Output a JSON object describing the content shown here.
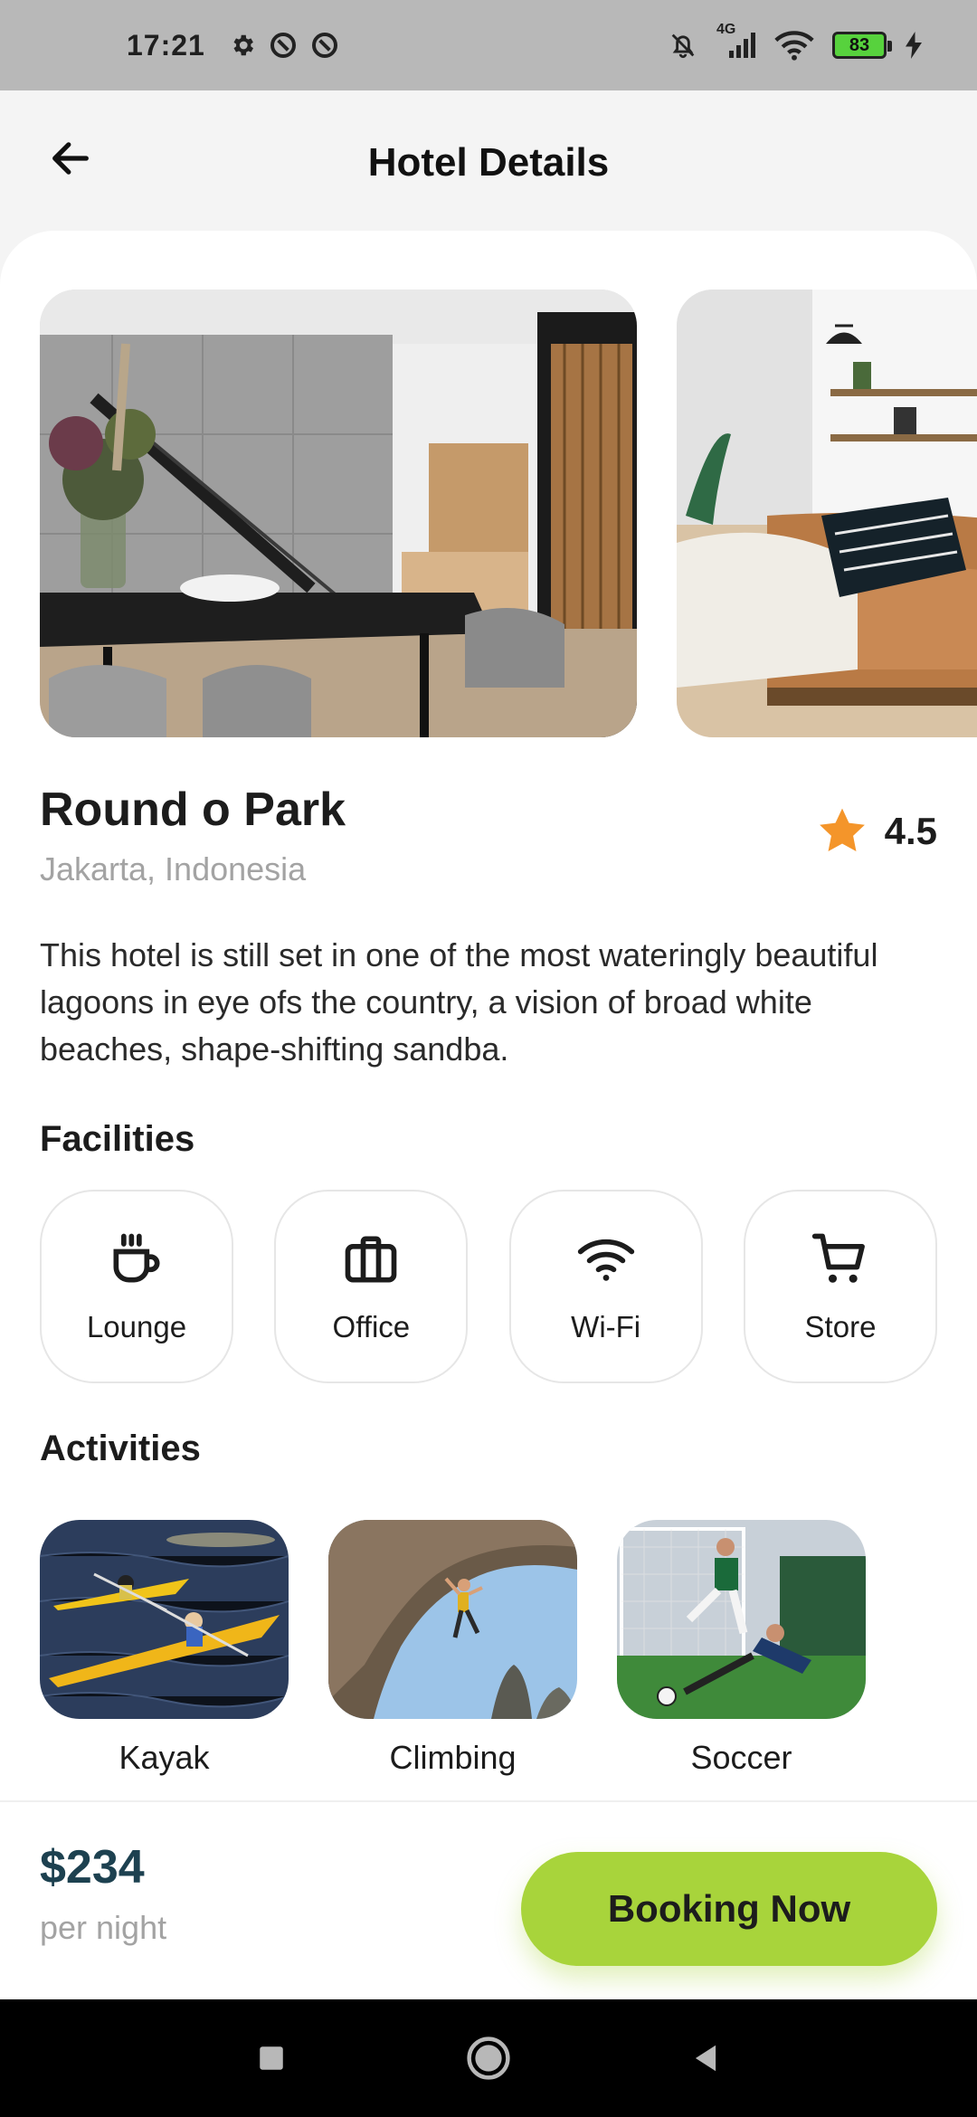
{
  "status_bar": {
    "time": "17:21",
    "network": "4G",
    "battery": "83",
    "icons": [
      "gear-icon",
      "data-saver-icon",
      "data-saver-icon",
      "bell-off-icon",
      "signal-icon",
      "wifi-icon",
      "battery-icon",
      "charging-icon"
    ]
  },
  "header": {
    "title": "Hotel Details",
    "back_icon": "arrow-left-icon"
  },
  "gallery": {
    "images": [
      "interior-dining-stairs-photo",
      "living-room-sofa-photo"
    ]
  },
  "hotel": {
    "name": "Round o Park",
    "location": "Jakarta, Indonesia",
    "rating": "4.5",
    "rating_icon": "star-icon",
    "description": "This hotel is still set in one of the most wateringly beautiful lagoons in eye ofs the country, a vision of broad white beaches, shape-shifting sandba."
  },
  "facilities": {
    "title": "Facilities",
    "items": [
      {
        "label": "Lounge",
        "icon": "coffee-cup-icon"
      },
      {
        "label": "Office",
        "icon": "briefcase-icon"
      },
      {
        "label": "Wi-Fi",
        "icon": "wifi-icon"
      },
      {
        "label": "Store",
        "icon": "cart-icon"
      }
    ]
  },
  "activities": {
    "title": "Activities",
    "items": [
      {
        "label": "Kayak"
      },
      {
        "label": "Climbing"
      },
      {
        "label": "Soccer"
      }
    ]
  },
  "booking": {
    "price": "$234",
    "unit": "per night",
    "button_label": "Booking Now"
  },
  "colors": {
    "accent": "#a8d43b",
    "price": "#1d4150",
    "star": "#f4952a",
    "muted": "#a3a3a3"
  }
}
